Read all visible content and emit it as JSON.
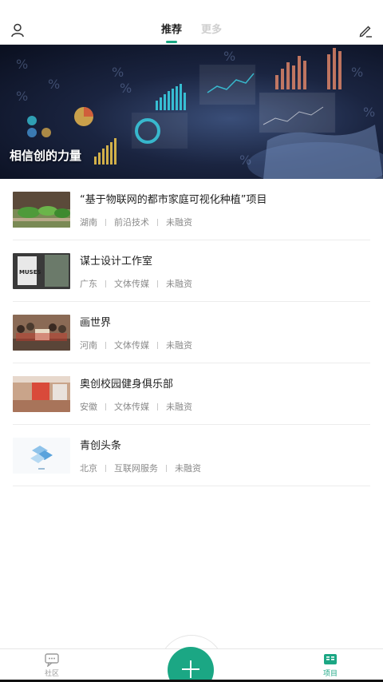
{
  "header": {
    "tabs": [
      {
        "label": "推荐",
        "active": true
      },
      {
        "label": "更多",
        "active": false
      }
    ],
    "user_icon": "user-icon",
    "edit_icon": "edit-icon"
  },
  "banner": {
    "title": "相信创的力量"
  },
  "projects": [
    {
      "title": "“基于物联网的都市家庭可视化种植”项目",
      "region": "湖南",
      "industry": "前沿技术",
      "funding": "未融资"
    },
    {
      "title": "谋士设计工作室",
      "region": "广东",
      "industry": "文体传媒",
      "funding": "未融资"
    },
    {
      "title": "画世界",
      "region": "河南",
      "industry": "文体传媒",
      "funding": "未融资"
    },
    {
      "title": "奥创校园健身俱乐部",
      "region": "安徽",
      "industry": "文体传媒",
      "funding": "未融资"
    },
    {
      "title": "青创头条",
      "region": "北京",
      "industry": "互联网服务",
      "funding": "未融资"
    }
  ],
  "thumb_text": {
    "muses": "MUSES"
  },
  "bottom_nav": {
    "community_label": "社区",
    "projects_label": "项目",
    "fab_icon": "plus-icon"
  },
  "colors": {
    "accent": "#1ba784",
    "inactive_tab": "#cfcfcf",
    "meta_text": "#8a8a8a"
  }
}
